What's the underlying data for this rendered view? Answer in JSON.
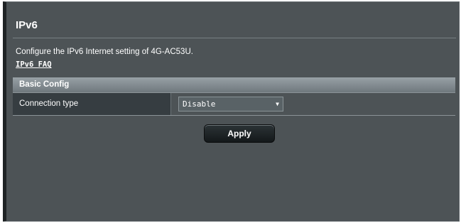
{
  "page": {
    "title": "IPv6",
    "description": "Configure the IPv6 Internet setting of 4G-AC53U.",
    "faq_link": "IPv6 FAQ"
  },
  "basic_config": {
    "header": "Basic Config",
    "connection_type": {
      "label": "Connection type",
      "selected": "Disable",
      "arrow_icon": "triangle-down"
    }
  },
  "actions": {
    "apply_label": "Apply"
  },
  "colors": {
    "panel_background": "#4d5356",
    "label_cell_background": "#363d41",
    "header_gradient_top": "#98a1a6",
    "button_background": "#1c2123",
    "text": "#ffffff"
  }
}
